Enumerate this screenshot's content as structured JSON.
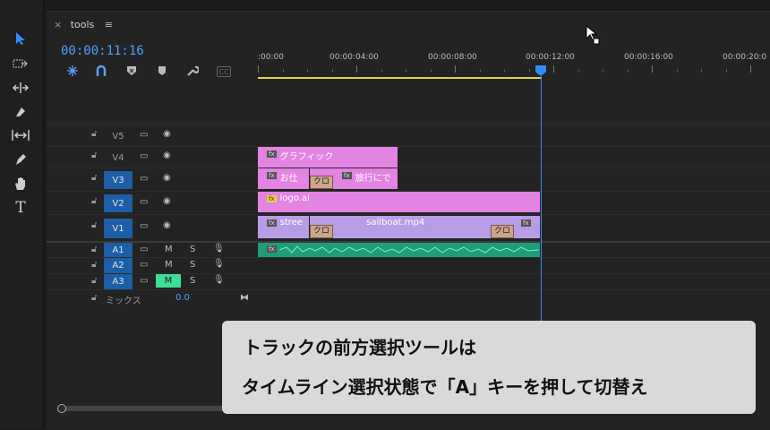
{
  "panel": {
    "close_glyph": "×",
    "tab_label": "tools",
    "menu_glyph": "≡"
  },
  "timecode": "00:00:11:16",
  "header_icons": [
    {
      "name": "snap-icon",
      "glyph": "⋇"
    },
    {
      "name": "linked-selection-icon",
      "glyph": "∩"
    },
    {
      "name": "add-marker-icon",
      "glyph": "▸"
    },
    {
      "name": "marker-icon",
      "glyph": "⬟"
    },
    {
      "name": "wrench-icon",
      "glyph": "🔧"
    },
    {
      "name": "captions-icon",
      "glyph": "CC"
    }
  ],
  "ruler": {
    "labels": [
      ":00:00",
      "00:00:04:00",
      "00:00:08:00",
      "00:00:12:00",
      "00:00:16:00",
      "00:00:20:0"
    ]
  },
  "tracks": {
    "video": [
      {
        "label": "V5",
        "targeted": false
      },
      {
        "label": "V4",
        "targeted": false
      },
      {
        "label": "V3",
        "targeted": true
      },
      {
        "label": "V2",
        "targeted": true
      },
      {
        "label": "V1",
        "targeted": true
      }
    ],
    "audio": [
      {
        "label": "A1",
        "m": "M",
        "s": "S",
        "targeted": true,
        "mute_on": false
      },
      {
        "label": "A2",
        "m": "M",
        "s": "S",
        "targeted": true,
        "mute_on": false
      },
      {
        "label": "A3",
        "m": "M",
        "s": "S",
        "targeted": true,
        "mute_on": true
      }
    ],
    "mix": {
      "label": "ミックス",
      "value": "0.0"
    }
  },
  "clips": {
    "v4": {
      "fx": "fx",
      "name": "グラフィック"
    },
    "v3a": {
      "fx": "fx",
      "name": "お仕"
    },
    "v3b": {
      "fx": "fx",
      "name": "旅行にで"
    },
    "v3_transition": "クロ",
    "v2": {
      "fx": "fx",
      "name": "logo.ai"
    },
    "v1a": {
      "fx": "fx",
      "name": "stree"
    },
    "v1b": {
      "name": "sailboat.mp4"
    },
    "v1_transition1": "クロ",
    "v1_transition2": "クロ",
    "v1_end_fx": "fx",
    "a1_fx": "fx"
  },
  "caption": {
    "line1": "トラックの前方選択ツールは",
    "line2": "タイムライン選択状態で「A」キーを押して切替え"
  },
  "colors": {
    "accent_blue": "#2f8cff",
    "clip_pink": "#e383e2",
    "clip_purple": "#b99ce6",
    "audio_green": "#1f9c78",
    "target_blue": "#1c5ea8"
  }
}
